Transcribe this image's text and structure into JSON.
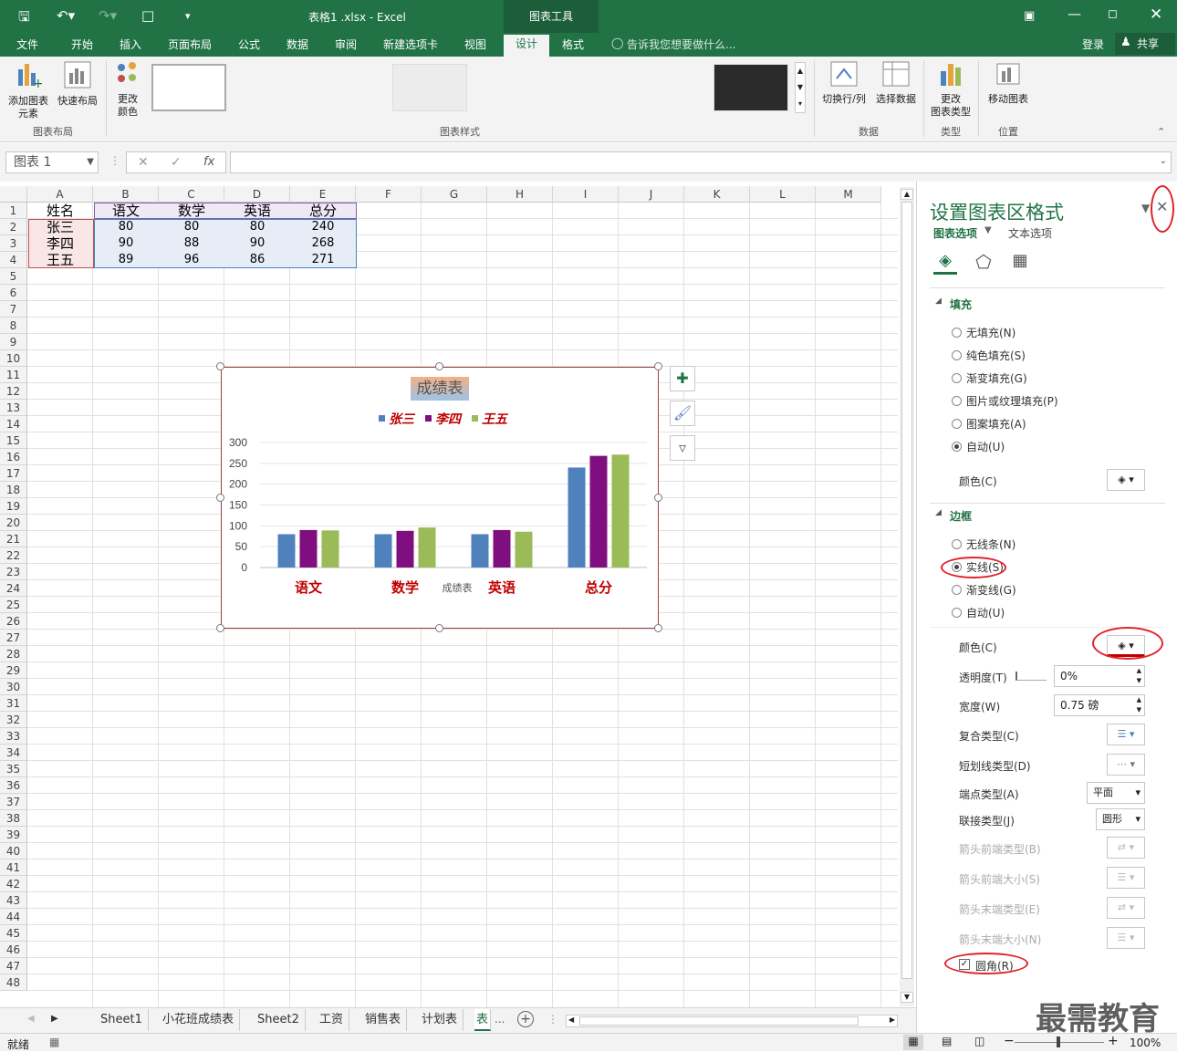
{
  "title_bar": {
    "document_title": "表格1 .xlsx - Excel",
    "context_label": "图表工具",
    "undo_icon": "undo-icon",
    "redo_icon": "redo-icon"
  },
  "tabs": [
    "文件",
    "开始",
    "插入",
    "页面布局",
    "公式",
    "数据",
    "审阅",
    "新建选项卡",
    "视图",
    "设计",
    "格式"
  ],
  "active_tab": "设计",
  "tell_me": "告诉我您想要做什么...",
  "login": "登录",
  "share": "共享",
  "ribbon": {
    "add_element": "添加图表\n元素",
    "quick_layout": "快速布局",
    "group_layout": "图表布局",
    "change_color": "更改\n颜色",
    "group_styles": "图表样式",
    "switch_row_col": "切换行/列",
    "select_data": "选择数据",
    "group_data": "数据",
    "change_type": "更改\n图表类型",
    "group_type": "类型",
    "move_chart": "移动图表",
    "group_location": "位置"
  },
  "formula_bar": {
    "name_box": "图表 1",
    "fx": "fx"
  },
  "columns": [
    "A",
    "B",
    "C",
    "D",
    "E",
    "F",
    "G",
    "H",
    "I",
    "J",
    "K",
    "L",
    "M"
  ],
  "rows": [
    "1",
    "2",
    "3",
    "4",
    "5",
    "6",
    "7",
    "8",
    "9",
    "10",
    "11",
    "12",
    "13",
    "14",
    "15",
    "16",
    "17",
    "18",
    "19",
    "20",
    "21",
    "22",
    "23",
    "24",
    "25",
    "26",
    "27",
    "28",
    "29",
    "30",
    "31",
    "32",
    "33",
    "34",
    "35",
    "36",
    "37",
    "38",
    "39",
    "40",
    "41",
    "42",
    "43",
    "44",
    "45",
    "46",
    "47",
    "48"
  ],
  "table": {
    "header": [
      "姓名",
      "语文",
      "数学",
      "英语",
      "总分"
    ],
    "rows": [
      [
        "张三",
        "80",
        "80",
        "80",
        "240"
      ],
      [
        "李四",
        "90",
        "88",
        "90",
        "268"
      ],
      [
        "王五",
        "89",
        "96",
        "86",
        "271"
      ]
    ]
  },
  "chart_data": {
    "type": "bar",
    "title": "成绩表",
    "categories": [
      "语文",
      "数学",
      "英语",
      "总分"
    ],
    "series": [
      {
        "name": "张三",
        "values": [
          80,
          80,
          80,
          240
        ],
        "color": "#4f81bd"
      },
      {
        "name": "李四",
        "values": [
          90,
          88,
          90,
          268
        ],
        "color": "#7f0f7e"
      },
      {
        "name": "王五",
        "values": [
          89,
          96,
          86,
          271
        ],
        "color": "#9bbb59"
      }
    ],
    "xlabel": "成绩表",
    "ylabel": "",
    "ylim": [
      0,
      300
    ],
    "yticks": [
      "300",
      "250",
      "200",
      "150",
      "100",
      "50",
      "0"
    ],
    "legend": "top",
    "grid": true
  },
  "sheet_tabs": [
    "Sheet1",
    "小花班成绩表",
    "Sheet2",
    "工资",
    "销售表",
    "计划表",
    "表"
  ],
  "status": {
    "ready": "就绪",
    "zoom": "100%"
  },
  "pane": {
    "title": "设置图表区格式",
    "tab_chart_options": "图表选项",
    "tab_text_options": "文本选项",
    "fill_section": "填充",
    "fill_options": [
      "无填充(N)",
      "纯色填充(S)",
      "渐变填充(G)",
      "图片或纹理填充(P)",
      "图案填充(A)",
      "自动(U)"
    ],
    "fill_selected": "自动(U)",
    "color_label": "颜色(C)",
    "border_section": "边框",
    "border_options": [
      "无线条(N)",
      "实线(S)",
      "渐变线(G)",
      "自动(U)"
    ],
    "border_selected": "实线(S)",
    "border_color_label": "颜色(C)",
    "transparency_label": "透明度(T)",
    "transparency_value": "0%",
    "width_label": "宽度(W)",
    "width_value": "0.75 磅",
    "compound_label": "复合类型(C)",
    "dash_label": "短划线类型(D)",
    "cap_label": "端点类型(A)",
    "cap_value": "平面",
    "join_label": "联接类型(J)",
    "join_value": "圆形",
    "arrow_begin_type": "箭头前端类型(B)",
    "arrow_begin_size": "箭头前端大小(S)",
    "arrow_end_type": "箭头末端类型(E)",
    "arrow_end_size": "箭头末端大小(N)",
    "rounded_corners": "圆角(R)",
    "rounded_checked": true
  },
  "watermark": "最需教育"
}
